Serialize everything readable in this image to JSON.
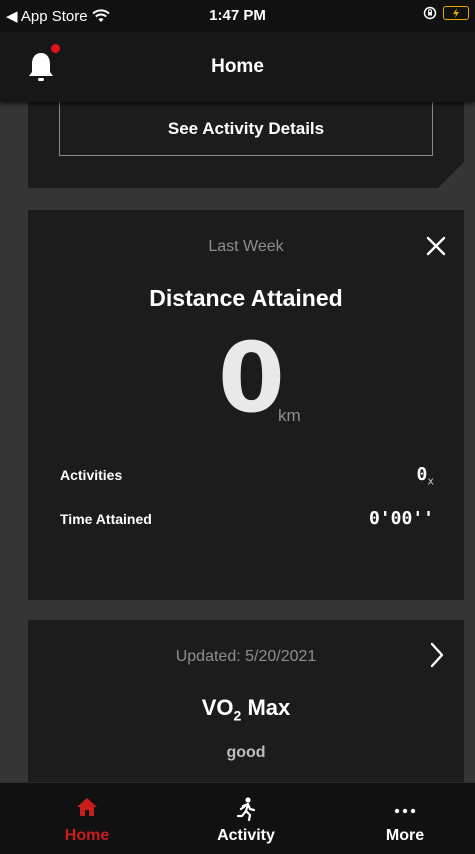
{
  "status_bar": {
    "back_label": "◀ App Store",
    "time": "1:47 PM"
  },
  "nav": {
    "title": "Home"
  },
  "activity_card": {
    "details_button_label": "See Activity Details"
  },
  "distance_card": {
    "period": "Last Week",
    "title": "Distance Attained",
    "value": "0",
    "unit": "km",
    "activities_label": "Activities",
    "activities_value": "0",
    "activities_suffix": "x",
    "time_label": "Time Attained",
    "time_value": "0'00''"
  },
  "vo2_card": {
    "updated": "Updated: 5/20/2021",
    "title_prefix": "VO",
    "title_subscript": "2",
    "title_suffix": " Max",
    "rating": "good"
  },
  "tab_bar": {
    "tabs": [
      {
        "label": "Home",
        "icon": "home-icon",
        "active": true
      },
      {
        "label": "Activity",
        "icon": "running-icon",
        "active": false
      },
      {
        "label": "More",
        "icon": "more-icon",
        "active": false
      }
    ]
  },
  "colors": {
    "accent": "#c81d1d",
    "notification_dot": "#e0151b",
    "battery": "#e8a500",
    "card_bg": "#1c1c1c",
    "content_bg": "#353535"
  }
}
